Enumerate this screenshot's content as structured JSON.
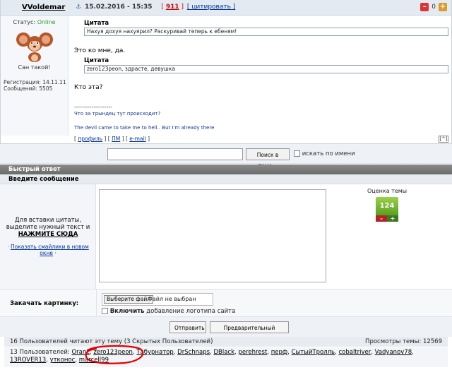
{
  "post": {
    "author": "VVoldemar",
    "anchor_glyph": "⚓",
    "date": "15.02.2016 - 15:35",
    "open_bracket": "[",
    "post_number": "911",
    "mid_bracket": "]",
    "cite_link": "[ цитировать ]",
    "rep_count": "0",
    "status_label": "Статус:",
    "status_value": "Online",
    "avatar_caption": "Сан такой!",
    "reg_line": "Регистрация: 14.11.11",
    "posts_line": "Сообщений: 5505",
    "quote_title_1": "Цитата",
    "quote_text_1": "Нахуя дохуя нахуярил? Раскуривай теперь к ебеням!",
    "reply_1": "Это ко мне, да.",
    "quote_title_2": "Цитата",
    "quote_text_2": "zero123peon, здрасте, девушка",
    "reply_2": "Кто эта?",
    "sig_dashes": "--------------------",
    "sig_line_1": "Что за трындец тут происходит?",
    "sig_line_2": "The devil came to take me to hell.. But I'm already there",
    "footer_links": {
      "open": "[",
      "profile": "профиль",
      "sep1": "] [",
      "pm": "ПМ",
      "sep2": "] [",
      "email": "e-mail",
      "close": "]"
    },
    "top_btn": "[^]"
  },
  "search": {
    "input_value": "",
    "button_label": "Поиск в теме »",
    "name_search_label": "искать по имени"
  },
  "quick_reply": {
    "header": "Быстрый ответ",
    "enter_message": "Введите сообщение",
    "insert_hint": "Для вставки цитаты, выделите нужный текст и",
    "insert_strong": "НАЖМИТЕ СЮДА",
    "smilies_prefix": "·",
    "smilies_link": "Показать смайлики в новом окне",
    "smilies_suffix": "·",
    "message_value": "",
    "rating_title": "Оценка темы",
    "rating_value": "124",
    "rating_minus": "–",
    "rating_plus": "+"
  },
  "upload": {
    "label": "Закачать картинку:",
    "file_button": "Выберите файл",
    "file_none": "Файл не выбран",
    "logo_bold": "Включить",
    "logo_rest": "добавление логотипа сайта"
  },
  "buttons": {
    "submit": "Отправить",
    "preview": "Предварительный просмотр"
  },
  "stats": {
    "readers": "16 Пользователей читают эту тему (3 Скрытых Пользователей)",
    "views": "Просмотры темы: 12569"
  },
  "users": {
    "prefix": "13 Пользователей:",
    "list": [
      "Oranc",
      "zero123peon",
      "Табурнатор",
      "DrSchnaps",
      "DBlack",
      "perehrest",
      "перф",
      "СытыйТролль",
      "cobaltriver",
      "Vadyanov78",
      "13ROVER13",
      "утконос",
      "marcell99"
    ]
  },
  "colors": {
    "accent": "#003399",
    "status_online": "#2c9a2c",
    "post_number": "#cc0000",
    "rating_green": "#7fbf3a",
    "annotation_red": "#e00000"
  }
}
